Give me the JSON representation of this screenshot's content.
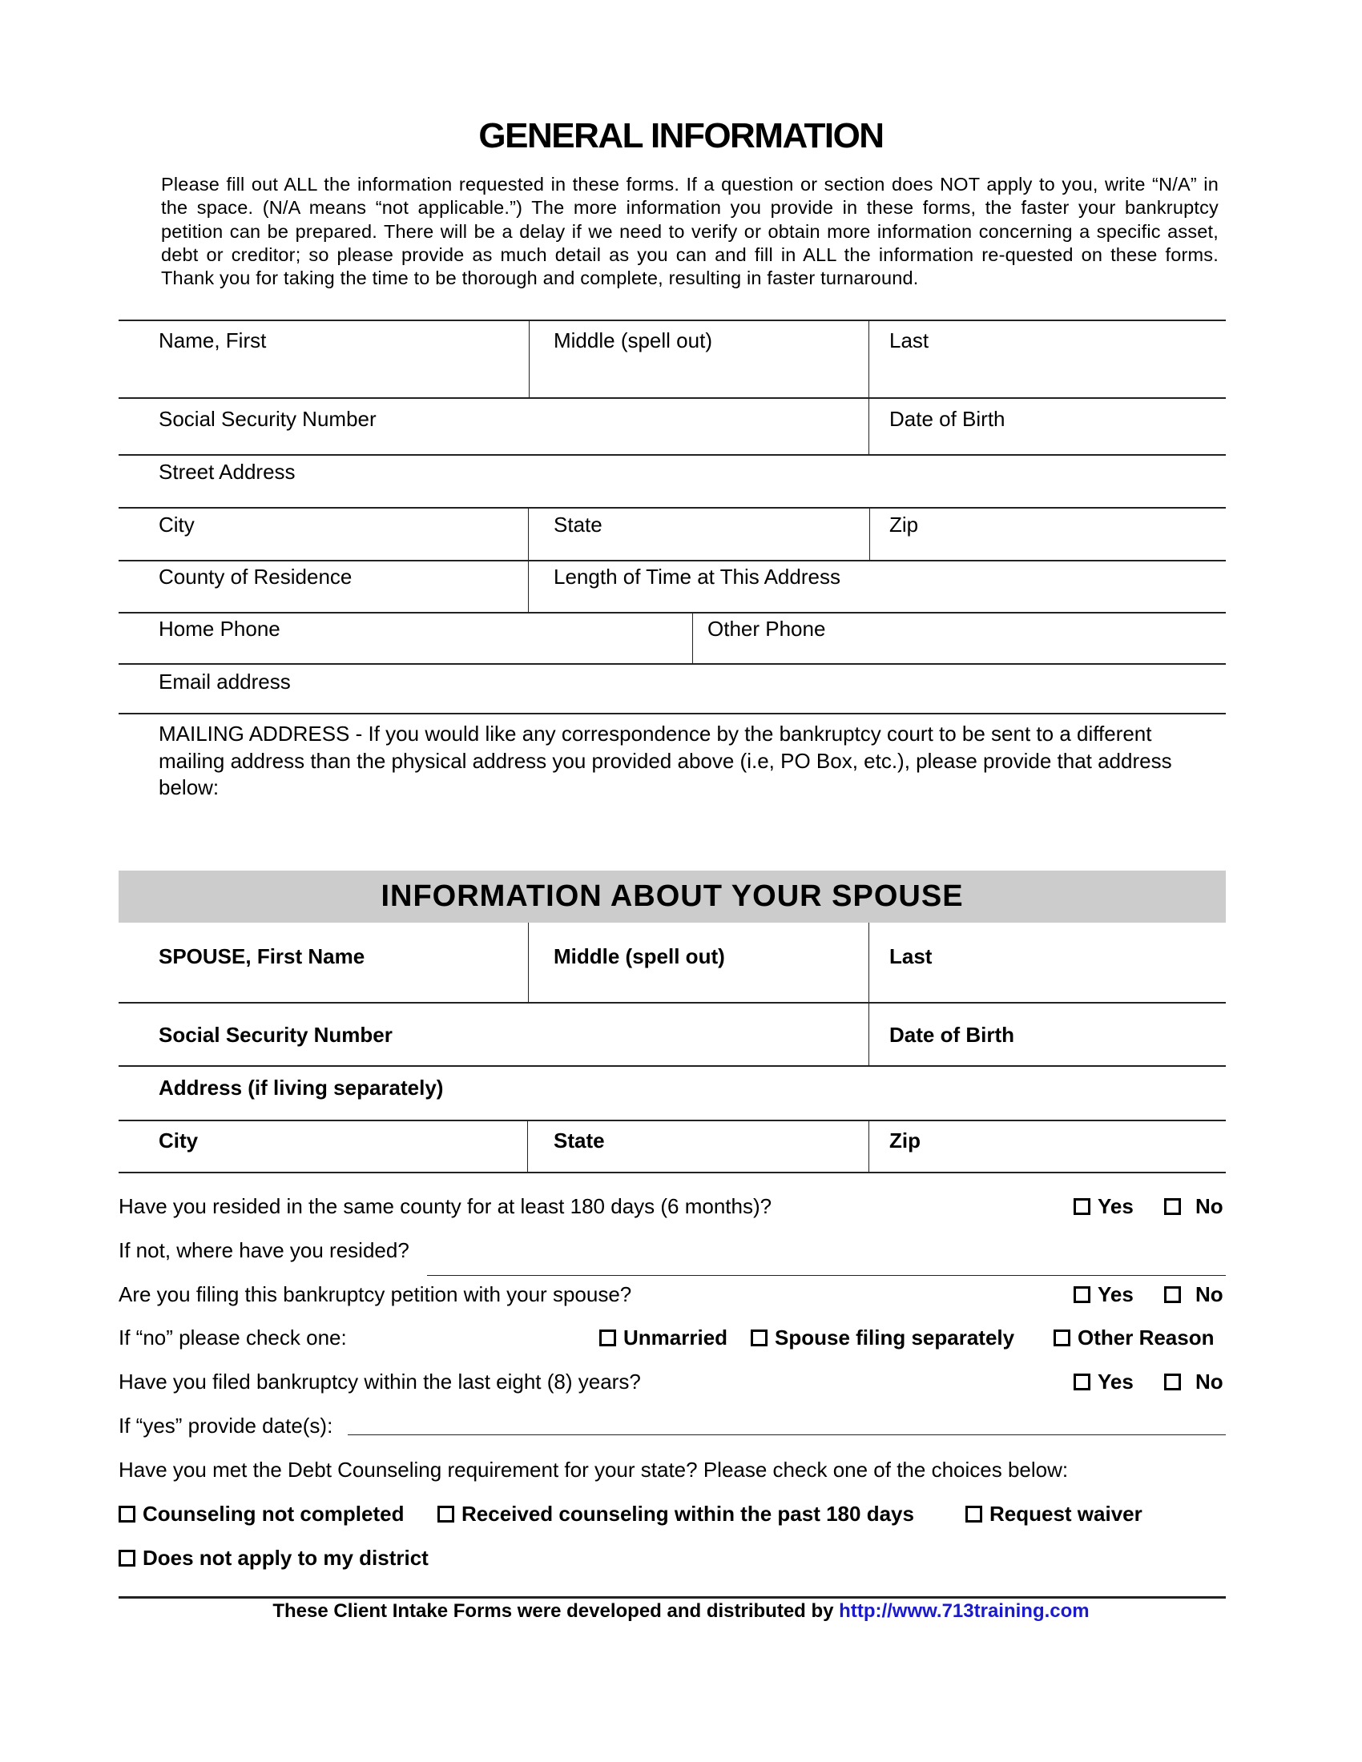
{
  "page": {
    "title": "GENERAL INFORMATION",
    "intro": "Please fill out ALL the information requested in these forms. If a question or section does NOT apply to you, write “N/A” in the space. (N/A means “not applicable.”) The more information you provide in these forms, the faster your bankruptcy petition can be prepared. There will be a delay if we need to verify or obtain more information concerning a specific asset, debt or creditor; so please provide as much detail as you can and fill in ALL the information re-quested on these forms. Thank you for taking the time to be thorough and complete, resulting in faster turnaround."
  },
  "debtor": {
    "first_name": "Name, First",
    "middle": "Middle (spell out)",
    "last": "Last",
    "ssn": "Social Security Number",
    "dob": "Date of Birth",
    "street": "Street Address",
    "city": "City",
    "state": "State",
    "zip": "Zip",
    "county": "County of Residence",
    "length_time": "Length of Time at This Address",
    "home_phone": "Home Phone",
    "other_phone": "Other Phone",
    "email": "Email address",
    "mailing_address": "MAILING ADDRESS - If you would like any correspondence by the bankruptcy court to be sent to a different mailing address than the physical address you provided above (i.e, PO Box, etc.), please provide that address below:"
  },
  "spouse": {
    "heading": "INFORMATION ABOUT YOUR SPOUSE",
    "first_name": "SPOUSE, First Name",
    "middle": "Middle (spell out)",
    "last": "Last",
    "ssn": "Social Security Number",
    "dob": "Date of Birth",
    "address": "Address (if living separately)",
    "city": "City",
    "state": "State",
    "zip": "Zip"
  },
  "questions": {
    "resided_180": "Have you resided in the same county for at least 180 days (6 months)?",
    "where_resided": "If not, where have you resided?",
    "filing_with_spouse": "Are you filing this bankruptcy petition with your spouse?",
    "if_no": "If “no” please check one:",
    "filed_8_years": "Have you filed bankruptcy within the last eight (8) years?",
    "if_yes_dates": "If “yes” provide date(s):",
    "debt_counseling": "Have you met the Debt Counseling requirement for your state? Please check one of the choices below:",
    "yes": "Yes",
    "no": "No",
    "unmarried": "Unmarried",
    "spouse_separately": "Spouse filing separately",
    "other_reason": "Other Reason",
    "counseling_not_completed": "Counseling not completed",
    "received_counseling": "Received counseling within the past 180 days",
    "request_waiver": "Request waiver",
    "does_not_apply": "Does not apply to my district"
  },
  "footer": {
    "text": "These Client Intake Forms were developed and distributed by ",
    "link": "http://www.713training.com",
    "link_color": "#1a1acc"
  }
}
